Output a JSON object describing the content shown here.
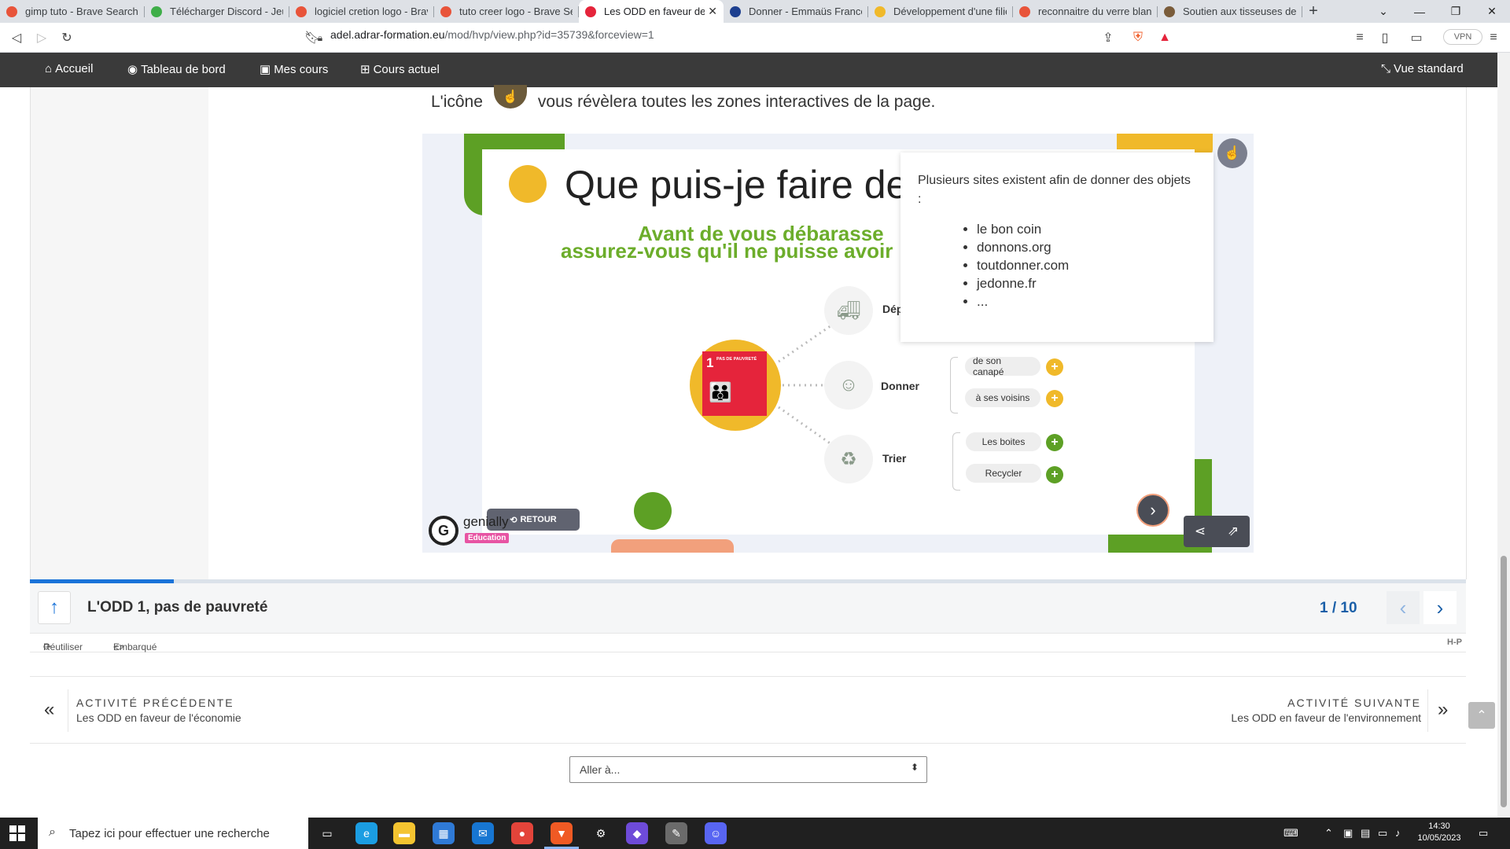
{
  "browser": {
    "tabs": [
      {
        "title": "gimp tuto - Brave Search",
        "fav_color": "#e8543a",
        "fav_icon": "brave-search-icon"
      },
      {
        "title": "Télécharger Discord - Jeux,",
        "fav_color": "#3fae49",
        "fav_icon": "star-icon"
      },
      {
        "title": "logiciel cretion logo - Brave",
        "fav_color": "#e8543a",
        "fav_icon": "brave-search-icon"
      },
      {
        "title": "tuto creer logo - Brave Sear",
        "fav_color": "#e8543a",
        "fav_icon": "brave-search-icon"
      },
      {
        "title": "Les ODD en faveur de l'",
        "fav_color": "#e5243b",
        "fav_icon": "odd-icon",
        "active": true
      },
      {
        "title": "Donner - Emmaüs France",
        "fav_color": "#1d3f8f",
        "fav_icon": "emmaus-icon"
      },
      {
        "title": "Développement d'une filièr",
        "fav_color": "#f0b92a",
        "fav_icon": "circle-icon"
      },
      {
        "title": "reconnaitre du verre blanc",
        "fav_color": "#e8543a",
        "fav_icon": "brave-search-icon"
      },
      {
        "title": "Soutien aux tisseuses de Zo",
        "fav_color": "#7a5c3a",
        "fav_icon": "page-icon"
      }
    ],
    "new_tab": "+",
    "url_host": "adel.adrar-formation.eu",
    "url_path": "/mod/hvp/view.php?id=35739&forceview=1",
    "vpn_label": "VPN",
    "shields_count": "1",
    "rewards_count": "1"
  },
  "navbar": {
    "items": [
      {
        "label": "Accueil",
        "icon": "home-icon"
      },
      {
        "label": "Tableau de bord",
        "icon": "dashboard-icon"
      },
      {
        "label": "Mes cours",
        "icon": "briefcase-icon"
      },
      {
        "label": "Cours actuel",
        "icon": "sitemap-icon"
      }
    ],
    "right_label": "Vue standard",
    "right_icon": "compress-icon"
  },
  "intro": {
    "before": "L'icône",
    "after": "vous révèlera toutes les zones interactives de la page."
  },
  "slide": {
    "headline": "Que puis-je faire de",
    "subtitle_line1": "Avant de vous débarasse",
    "subtitle_line2": "assurez-vous qu'il ne puisse avoir",
    "odd_number": "1",
    "odd_title": "PAS DE PAUVRETÉ",
    "actions": [
      {
        "label": "Dép",
        "icon": "van-icon"
      },
      {
        "label": "Donner",
        "icon": "people-icon"
      },
      {
        "label": "Trier",
        "icon": "recycle-icon"
      }
    ],
    "donner_pills": [
      "de son canapé",
      "à ses voisins"
    ],
    "trier_pills": [
      "Les boites",
      "Recycler"
    ],
    "popup_text": "Plusieurs sites existent afin de donner des objets :",
    "popup_sites": [
      "le bon coin",
      "donnons.org",
      "toutdonner.com",
      "jedonne.fr",
      "..."
    ],
    "retour_label": "RETOUR",
    "brand": "genially",
    "brand_badge": "Education"
  },
  "h5p": {
    "title": "L'ODD 1, pas de pauvreté",
    "counter": "1 / 10",
    "progress_fraction": 0.1,
    "reuse_label": "Réutiliser",
    "embed_label": "Embarqué",
    "h5p_logo": "H-P"
  },
  "activity_nav": {
    "prev_kicker": "ACTIVITÉ PRÉCÉDENTE",
    "prev_title": "Les ODD en faveur de l'économie",
    "next_kicker": "ACTIVITÉ SUIVANTE",
    "next_title": "Les ODD en faveur de l'environnement"
  },
  "jump": {
    "placeholder": "Aller à..."
  },
  "taskbar": {
    "search_placeholder": "Tapez ici pour effectuer une recherche",
    "apps": [
      {
        "name": "task-view-icon",
        "color": "#202020",
        "glyph": "▭"
      },
      {
        "name": "edge-icon",
        "color": "#1b9de2",
        "glyph": "e"
      },
      {
        "name": "file-explorer-icon",
        "color": "#f4c430",
        "glyph": "▬"
      },
      {
        "name": "store-icon",
        "color": "#2f7ad6",
        "glyph": "▦"
      },
      {
        "name": "mail-icon",
        "color": "#1776d2",
        "glyph": "✉"
      },
      {
        "name": "chrome-icon",
        "color": "#e3443a",
        "glyph": "●"
      },
      {
        "name": "brave-icon",
        "color": "#f05a24",
        "glyph": "▼"
      },
      {
        "name": "settings-icon",
        "color": "#202020",
        "glyph": "⚙"
      },
      {
        "name": "paint-icon",
        "color": "#6e4bd8",
        "glyph": "◆"
      },
      {
        "name": "gimp-icon",
        "color": "#6b6b6b",
        "glyph": "✎"
      },
      {
        "name": "discord-icon",
        "color": "#5865f2",
        "glyph": "☺"
      }
    ],
    "time": "14:30",
    "date": "10/05/2023"
  }
}
